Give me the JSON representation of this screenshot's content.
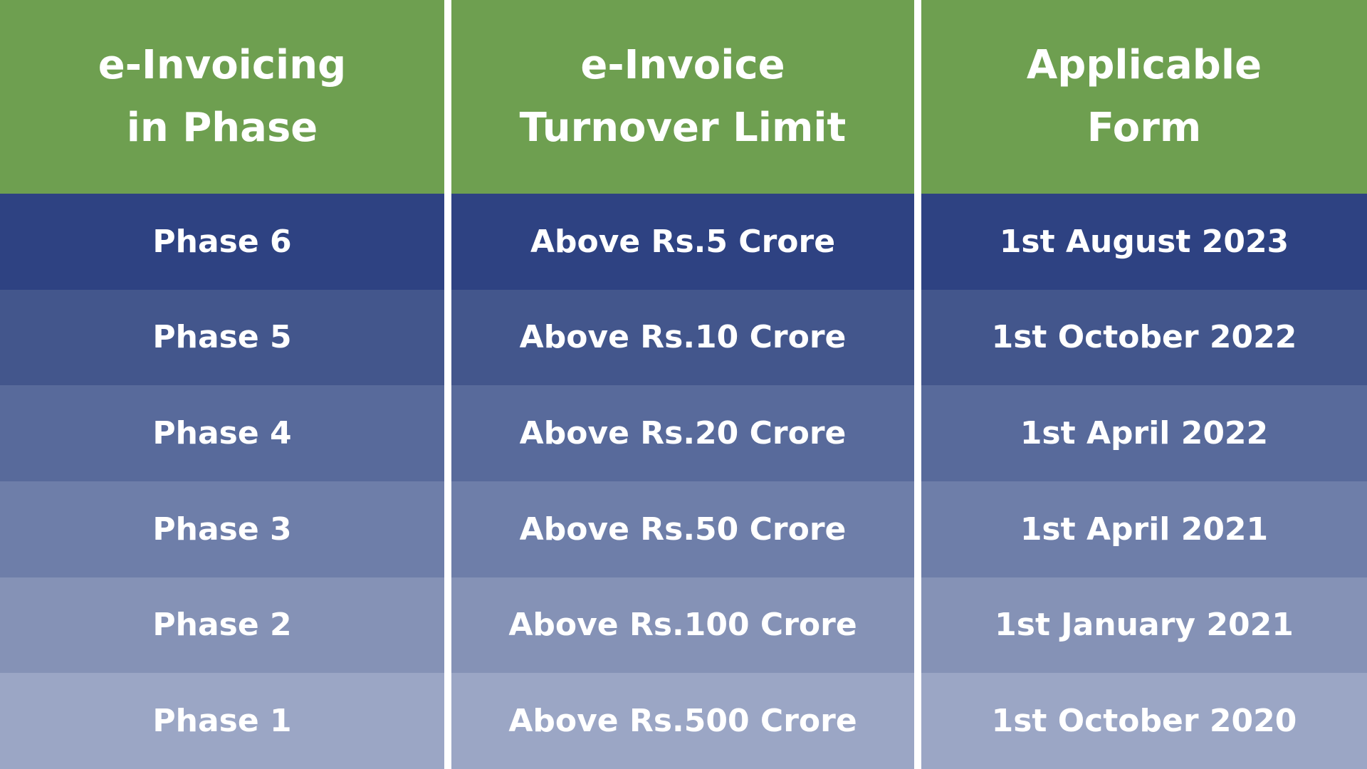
{
  "colors": {
    "header": "#6e9f50",
    "rows": [
      "#2e4282",
      "#43568c",
      "#586a9b",
      "#6e7ea9",
      "#8592b6",
      "#9ba6c5"
    ]
  },
  "headers": [
    "e-Invoicing\nin Phase",
    "e-Invoice\nTurnover Limit",
    "Applicable\nForm"
  ],
  "rows": [
    [
      "Phase 6",
      "Above Rs.5 Crore",
      "1st August 2023"
    ],
    [
      "Phase 5",
      "Above Rs.10 Crore",
      "1st October 2022"
    ],
    [
      "Phase 4",
      "Above Rs.20 Crore",
      "1st April 2022"
    ],
    [
      "Phase 3",
      "Above Rs.50 Crore",
      "1st April 2021"
    ],
    [
      "Phase 2",
      "Above Rs.100 Crore",
      "1st January 2021"
    ],
    [
      "Phase 1",
      "Above Rs.500 Crore",
      "1st October 2020"
    ]
  ]
}
